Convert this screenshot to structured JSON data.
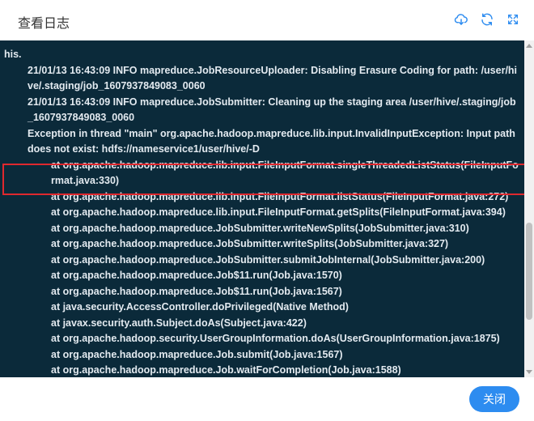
{
  "dialog": {
    "title": "查看日志",
    "icons": [
      "cloud-download-icon",
      "refresh-icon",
      "fullscreen-icon"
    ],
    "accent_color": "#2d8cf0",
    "close_label": "关闭"
  },
  "log": {
    "background": "#0b2a3a",
    "highlight_color": "#e0282e",
    "lines": [
      {
        "indent": 0,
        "text": "his."
      },
      {
        "indent": 1,
        "text": "21/01/13 16:43:09 INFO mapreduce.JobResourceUploader: Disabling Erasure Coding for path: /user/hive/.staging/job_1607937849083_0060"
      },
      {
        "indent": 1,
        "text": "21/01/13 16:43:09 INFO mapreduce.JobSubmitter: Cleaning up the staging area /user/hive/.staging/job_1607937849083_0060"
      },
      {
        "indent": 1,
        "text": "Exception in thread \"main\" org.apache.hadoop.mapreduce.lib.input.InvalidInputException: Input path does not exist: hdfs://nameservice1/user/hive/-D"
      },
      {
        "indent": 2,
        "text": "at org.apache.hadoop.mapreduce.lib.input.FileInputFormat.singleThreadedListStatus(FileInputFormat.java:330)"
      },
      {
        "indent": 2,
        "text": "at org.apache.hadoop.mapreduce.lib.input.FileInputFormat.listStatus(FileInputFormat.java:272)"
      },
      {
        "indent": 2,
        "text": "at org.apache.hadoop.mapreduce.lib.input.FileInputFormat.getSplits(FileInputFormat.java:394)"
      },
      {
        "indent": 2,
        "text": "at org.apache.hadoop.mapreduce.JobSubmitter.writeNewSplits(JobSubmitter.java:310)"
      },
      {
        "indent": 2,
        "text": "at org.apache.hadoop.mapreduce.JobSubmitter.writeSplits(JobSubmitter.java:327)"
      },
      {
        "indent": 2,
        "text": "at org.apache.hadoop.mapreduce.JobSubmitter.submitJobInternal(JobSubmitter.java:200)"
      },
      {
        "indent": 2,
        "text": "at org.apache.hadoop.mapreduce.Job$11.run(Job.java:1570)"
      },
      {
        "indent": 2,
        "text": "at org.apache.hadoop.mapreduce.Job$11.run(Job.java:1567)"
      },
      {
        "indent": 2,
        "text": "at java.security.AccessController.doPrivileged(Native Method)"
      },
      {
        "indent": 2,
        "text": "at javax.security.auth.Subject.doAs(Subject.java:422)"
      },
      {
        "indent": 2,
        "text": "at org.apache.hadoop.security.UserGroupInformation.doAs(UserGroupInformation.java:1875)"
      },
      {
        "indent": 2,
        "text": "at org.apache.hadoop.mapreduce.Job.submit(Job.java:1567)"
      },
      {
        "indent": 2,
        "text": "at org.apache.hadoop.mapreduce.Job.waitForCompletion(Job.java:1588)"
      }
    ]
  }
}
